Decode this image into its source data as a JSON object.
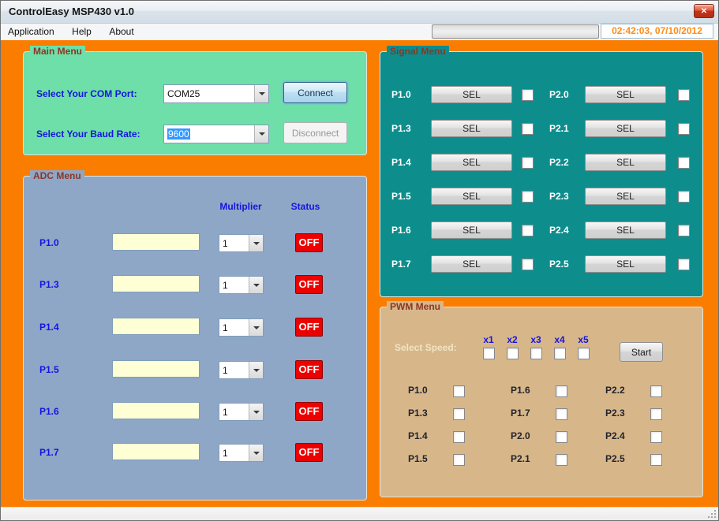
{
  "window": {
    "title": "ControlEasy MSP430 v1.0",
    "datetime": "02:42:03, 07/10/2012"
  },
  "icons": {
    "close": "✕"
  },
  "menu": {
    "items": [
      {
        "label": "Application"
      },
      {
        "label": "Help"
      },
      {
        "label": "About"
      }
    ]
  },
  "main_menu": {
    "title": "Main Menu",
    "com_port_label": "Select Your COM Port:",
    "com_port_value": "COM25",
    "baud_rate_label": "Select Your Baud Rate:",
    "baud_rate_value": "9600",
    "connect_label": "Connect",
    "disconnect_label": "Disconnect"
  },
  "adc_menu": {
    "title": "ADC Menu",
    "multiplier_header": "Multiplier",
    "status_header": "Status",
    "rows": [
      {
        "port": "P1.0",
        "value": "",
        "multiplier": "1",
        "status": "OFF"
      },
      {
        "port": "P1.3",
        "value": "",
        "multiplier": "1",
        "status": "OFF"
      },
      {
        "port": "P1.4",
        "value": "",
        "multiplier": "1",
        "status": "OFF"
      },
      {
        "port": "P1.5",
        "value": "",
        "multiplier": "1",
        "status": "OFF"
      },
      {
        "port": "P1.6",
        "value": "",
        "multiplier": "1",
        "status": "OFF"
      },
      {
        "port": "P1.7",
        "value": "",
        "multiplier": "1",
        "status": "OFF"
      }
    ]
  },
  "signal_menu": {
    "title": "Signal Menu",
    "sel_button_label": "SEL",
    "rows": [
      {
        "left_port": "P1.0",
        "right_port": "P2.0",
        "left_checked": false,
        "right_checked": false
      },
      {
        "left_port": "P1.3",
        "right_port": "P2.1",
        "left_checked": false,
        "right_checked": false
      },
      {
        "left_port": "P1.4",
        "right_port": "P2.2",
        "left_checked": false,
        "right_checked": false
      },
      {
        "left_port": "P1.5",
        "right_port": "P2.3",
        "left_checked": false,
        "right_checked": false
      },
      {
        "left_port": "P1.6",
        "right_port": "P2.4",
        "left_checked": false,
        "right_checked": false
      },
      {
        "left_port": "P1.7",
        "right_port": "P2.5",
        "left_checked": false,
        "right_checked": false
      }
    ]
  },
  "pwm_menu": {
    "title": "PWM Menu",
    "select_speed_label": "Select Speed:",
    "start_label": "Start",
    "speeds": [
      {
        "label": "x1",
        "checked": false
      },
      {
        "label": "x2",
        "checked": false
      },
      {
        "label": "x3",
        "checked": false
      },
      {
        "label": "x4",
        "checked": false
      },
      {
        "label": "x5",
        "checked": false
      }
    ],
    "columns": [
      {
        "ports": [
          {
            "label": "P1.0",
            "checked": false
          },
          {
            "label": "P1.3",
            "checked": false
          },
          {
            "label": "P1.4",
            "checked": false
          },
          {
            "label": "P1.5",
            "checked": false
          }
        ]
      },
      {
        "ports": [
          {
            "label": "P1.6",
            "checked": false
          },
          {
            "label": "P1.7",
            "checked": false
          },
          {
            "label": "P2.0",
            "checked": false
          },
          {
            "label": "P2.1",
            "checked": false
          }
        ]
      },
      {
        "ports": [
          {
            "label": "P2.2",
            "checked": false
          },
          {
            "label": "P2.3",
            "checked": false
          },
          {
            "label": "P2.4",
            "checked": false
          },
          {
            "label": "P2.5",
            "checked": false
          }
        ]
      }
    ]
  },
  "colors": {
    "window_background": "#FB7D00",
    "main_menu_panel": "#6EDFA8",
    "adc_panel": "#8FA7C7",
    "signal_panel": "#0E8D8D",
    "pwm_panel": "#D7B78A",
    "label_blue": "#1515E0",
    "group_title": "#8B3626",
    "status_off_red": "#EC0000",
    "datetime_orange": "#FF8C1A"
  }
}
